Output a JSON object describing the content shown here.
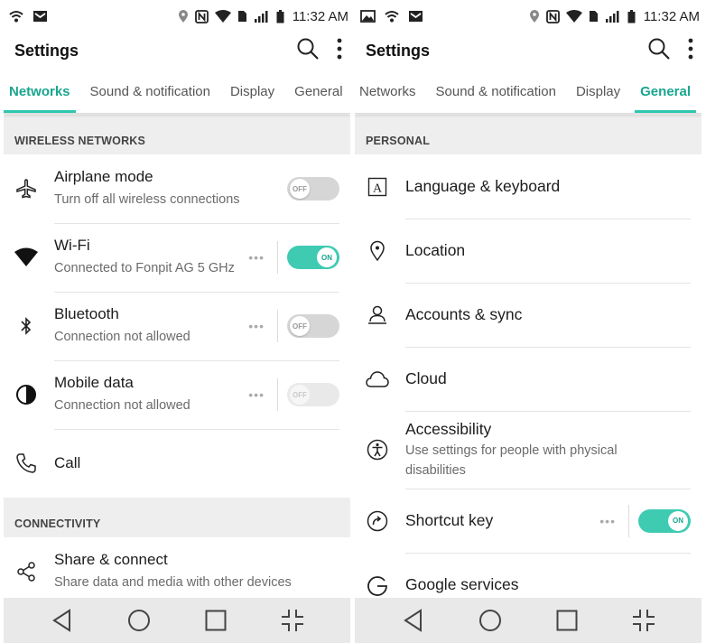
{
  "status": {
    "time": "11:32 AM"
  },
  "left": {
    "title": "Settings",
    "tabs": [
      "Networks",
      "Sound & notification",
      "Display",
      "General"
    ],
    "sections": {
      "wireless": "WIRELESS NETWORKS",
      "connectivity": "CONNECTIVITY"
    },
    "items": [
      {
        "title": "Airplane mode",
        "subtitle": "Turn off all wireless connections",
        "toggle": "OFF",
        "icon": "airplane-icon"
      },
      {
        "title": "Wi-Fi",
        "subtitle": "Connected to Fonpit AG 5 GHz",
        "toggle": "ON",
        "icon": "wifi-icon"
      },
      {
        "title": "Bluetooth",
        "subtitle": "Connection not allowed",
        "toggle": "OFF",
        "icon": "bluetooth-icon"
      },
      {
        "title": "Mobile data",
        "subtitle": "Connection not allowed",
        "toggle": "OFF",
        "icon": "mobile-data-icon"
      },
      {
        "title": "Call",
        "icon": "phone-icon"
      },
      {
        "title": "Share & connect",
        "subtitle": "Share data and media with other devices",
        "icon": "share-icon"
      }
    ]
  },
  "right": {
    "title": "Settings",
    "tabs": [
      "Networks",
      "Sound & notification",
      "Display",
      "General"
    ],
    "sections": {
      "personal": "PERSONAL"
    },
    "items": [
      {
        "title": "Language & keyboard",
        "icon": "language-icon"
      },
      {
        "title": "Location",
        "icon": "location-pin-icon"
      },
      {
        "title": "Accounts & sync",
        "icon": "account-icon"
      },
      {
        "title": "Cloud",
        "icon": "cloud-icon"
      },
      {
        "title": "Accessibility",
        "subtitle_line1": "Use settings for people with physical",
        "subtitle_line2": "disabilities",
        "icon": "accessibility-icon"
      },
      {
        "title": "Shortcut key",
        "toggle": "ON",
        "icon": "shortcut-icon"
      },
      {
        "title": "Google services",
        "icon": "google-icon"
      }
    ]
  },
  "colors": {
    "accent": "#2cc7ad",
    "section_bg": "#eeeeee",
    "navbar_bg": "#e9e9e9"
  }
}
